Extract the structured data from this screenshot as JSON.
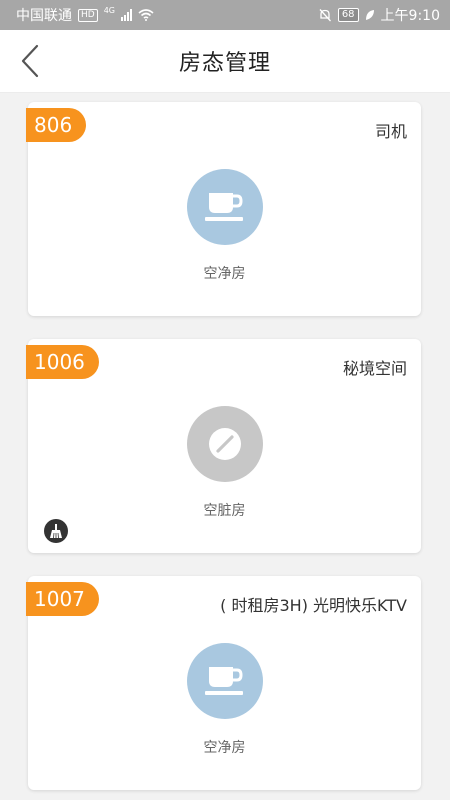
{
  "status_bar": {
    "carrier": "中国联通",
    "hd": "HD",
    "network": "4G",
    "battery": "68",
    "time": "上午9:10"
  },
  "header": {
    "title": "房态管理",
    "back_icon": "chevron-left-icon"
  },
  "rooms": [
    {
      "number": "806",
      "guest": "司机",
      "status": "空净房",
      "status_icon": "coffee-cup-icon",
      "status_color": "#a9c8e0",
      "cleaning": false
    },
    {
      "number": "1006",
      "guest": "秘境空间",
      "status": "空脏房",
      "status_icon": "slash-icon",
      "status_color": "#c7c7c7",
      "cleaning": true
    },
    {
      "number": "1007",
      "guest": "( 时租房3H) 光明快乐KTV",
      "status": "空净房",
      "status_icon": "coffee-cup-icon",
      "status_color": "#a9c8e0",
      "cleaning": false
    }
  ],
  "colors": {
    "accent": "#f7931e",
    "statusbar_bg": "#a7a7a7",
    "page_bg": "#f2f2f2"
  }
}
